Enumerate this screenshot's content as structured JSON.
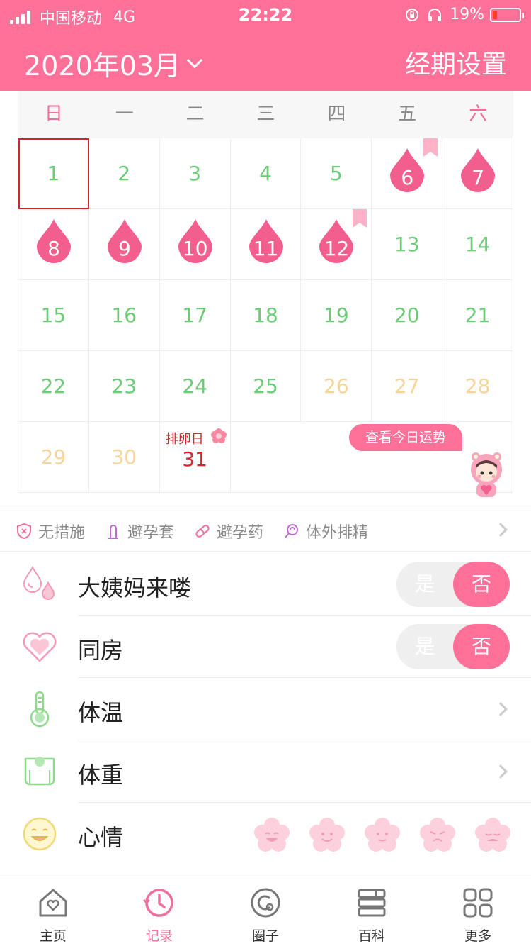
{
  "status_bar": {
    "carrier": "中国移动",
    "network": "4G",
    "time": "22:22",
    "battery": "19%"
  },
  "header": {
    "month_label": "2020年03月",
    "settings_label": "经期设置"
  },
  "calendar": {
    "weekdays": [
      "日",
      "一",
      "二",
      "三",
      "四",
      "五",
      "六"
    ],
    "days": [
      "1",
      "2",
      "3",
      "4",
      "5",
      "6",
      "7",
      "8",
      "9",
      "10",
      "11",
      "12",
      "13",
      "14",
      "15",
      "16",
      "17",
      "18",
      "19",
      "20",
      "21",
      "22",
      "23",
      "24",
      "25",
      "26",
      "27",
      "28",
      "29",
      "30",
      "31"
    ],
    "today": "1",
    "period_days": [
      "6",
      "7",
      "8",
      "9",
      "10",
      "11",
      "12"
    ],
    "ovulation_label": "排卵日",
    "fortune_button": "查看今日运势"
  },
  "contraception": {
    "items": [
      "无措施",
      "避孕套",
      "避孕药",
      "体外排精"
    ]
  },
  "records": {
    "period": {
      "label": "大姨妈来喽",
      "yes": "是",
      "no": "否",
      "value": "否"
    },
    "intimacy": {
      "label": "同房",
      "yes": "是",
      "no": "否",
      "value": "否"
    },
    "temperature": {
      "label": "体温"
    },
    "weight": {
      "label": "体重"
    },
    "mood": {
      "label": "心情"
    }
  },
  "tabbar": {
    "items": [
      "主页",
      "记录",
      "圈子",
      "百科",
      "更多"
    ],
    "active": "记录"
  },
  "colors": {
    "brand_pink": "#fd7199",
    "normal_day": "#6ccb76",
    "fertile_day": "#f7d59a",
    "today_border": "#d0262e"
  }
}
